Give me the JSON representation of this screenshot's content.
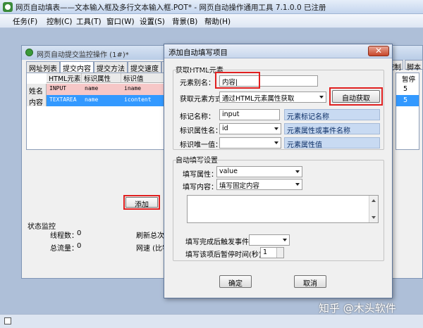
{
  "window": {
    "title": "网页自动填表——文本输入框及多行文本输入框.POT* - 网页自动操作通用工具 7.1.0.0 已注册"
  },
  "menu": [
    "任务(F)",
    "控制(C)",
    "工具(T)",
    "窗口(W)",
    "设置(S)",
    "背景(B)",
    "帮助(H)"
  ],
  "child_window": {
    "title": "网页自动提交监控操作 (1#)*",
    "tabs": [
      "网址列表",
      "提交内容",
      "提交方法",
      "提交速度",
      "伪装"
    ],
    "right_tabs": [
      "控制",
      "脚本"
    ],
    "grid": {
      "headers": [
        "HTML元素",
        "标识属性",
        "标识值"
      ],
      "rows": [
        {
          "head": "姓名",
          "tag": "INPUT",
          "attr": "name",
          "val": "iname",
          "num": "5"
        },
        {
          "head": "内容",
          "tag": "TEXTAREA",
          "attr": "name",
          "val": "icontent",
          "num": "5"
        }
      ],
      "right_header": "暂停"
    },
    "add_button": "添加",
    "status": {
      "title": "状态监控",
      "threads_label": "线程数：",
      "threads_value": "0",
      "traffic_label": "总流量：",
      "traffic_value": "0",
      "refresh_label": "刷新总次数",
      "speed_label": "网速 (比特"
    },
    "start_button": "开始"
  },
  "dialog": {
    "title": "添加自动填写项目",
    "close": "✕",
    "section1": "获取HTML元素",
    "alias_label": "元素别名：",
    "alias_value": "内容|",
    "method_label": "获取元素方式",
    "method_value": "通过HTML元素属性获取",
    "auto_button": "自动获取",
    "tag_label": "标记名称：",
    "tag_value": "input",
    "tag_hint": "元素标记名称",
    "attr_label": "标识属性名：",
    "attr_value": "id",
    "attr_hint": "元素属性或事件名称",
    "unique_label": "标识唯一值：",
    "unique_value": "",
    "unique_hint": "元素属性值",
    "section2": "自动填写设置",
    "fill_attr_label": "填写属性：",
    "fill_attr_value": "value",
    "fill_content_label": "填写内容：",
    "fill_content_value": "填写固定内容",
    "event_label": "填写完成后触发事件",
    "event_value": "",
    "pause_label": "填写该项后暂停时间(秒)",
    "pause_value": "1",
    "ok_button": "确定",
    "cancel_button": "取消"
  },
  "watermark": "知乎 @木头软件",
  "colors": {
    "accent_red": "#e02020",
    "selection_blue": "#3399ff",
    "hint_blue": "#c8daf2"
  }
}
